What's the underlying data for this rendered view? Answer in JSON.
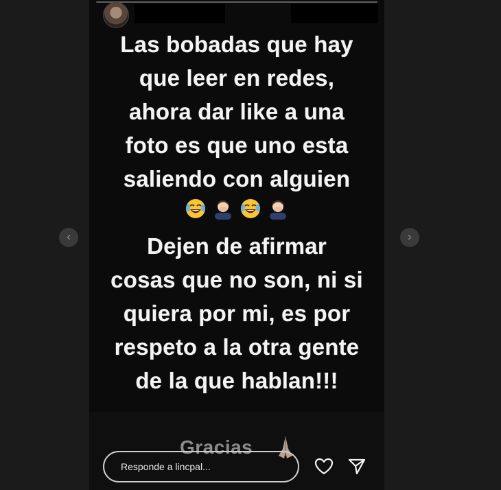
{
  "story": {
    "message_top": [
      "Las bobadas que hay",
      "que leer en redes,",
      "ahora dar like a una",
      "foto es que uno esta",
      "saliendo con alguien"
    ],
    "emojis": [
      "tears-of-joy-emoji",
      "man-facepalming-emoji",
      "tears-of-joy-emoji",
      "man-facepalming-emoji"
    ],
    "message_bottom": [
      "Dejen de afirmar",
      "cosas que no son, ni si",
      "quiera por mi, es por",
      "respeto a la otra gente",
      "de la que hablan!!!"
    ],
    "footer_text": "Gracias",
    "footer_emoji": "folded-hands-emoji"
  },
  "reply": {
    "placeholder": "Responde a lincpal..."
  },
  "nav": {
    "prev_icon": "chevron-left-icon",
    "next_icon": "chevron-right-icon",
    "prev_glyph": "‹",
    "next_glyph": "›"
  },
  "colors": {
    "page_bg": "#1b1b1b",
    "story_bg": "#0b0b0c",
    "text": "#f4f4f4",
    "muted_text": "#8c8c8c",
    "nav_button": "#3a3a3a"
  }
}
